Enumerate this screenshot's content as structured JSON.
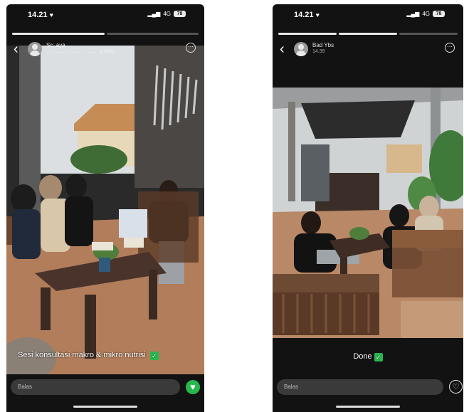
{
  "left_story": {
    "status": {
      "time": "14.21",
      "network": "4G",
      "battery": "78"
    },
    "header": {
      "user_name": "Sc..aya",
      "subtitle": "...... ........ ........ .. ........ ..y iaVa..."
    },
    "caption": "Sesi konsultasi makro & mikro nutrisi",
    "caption_badge": "✓",
    "reply_placeholder": "Balas",
    "like_icon": "heart-icon",
    "colors": {
      "like_active": "#27b84d"
    }
  },
  "right_story": {
    "status": {
      "time": "14.21",
      "network": "4G",
      "battery": "78"
    },
    "header": {
      "user_name": "Bad Ybs",
      "subtitle": "14.39"
    },
    "caption": "Done",
    "caption_badge": "✓",
    "reply_placeholder": "Balas",
    "like_icon": "heart-outline-icon"
  }
}
